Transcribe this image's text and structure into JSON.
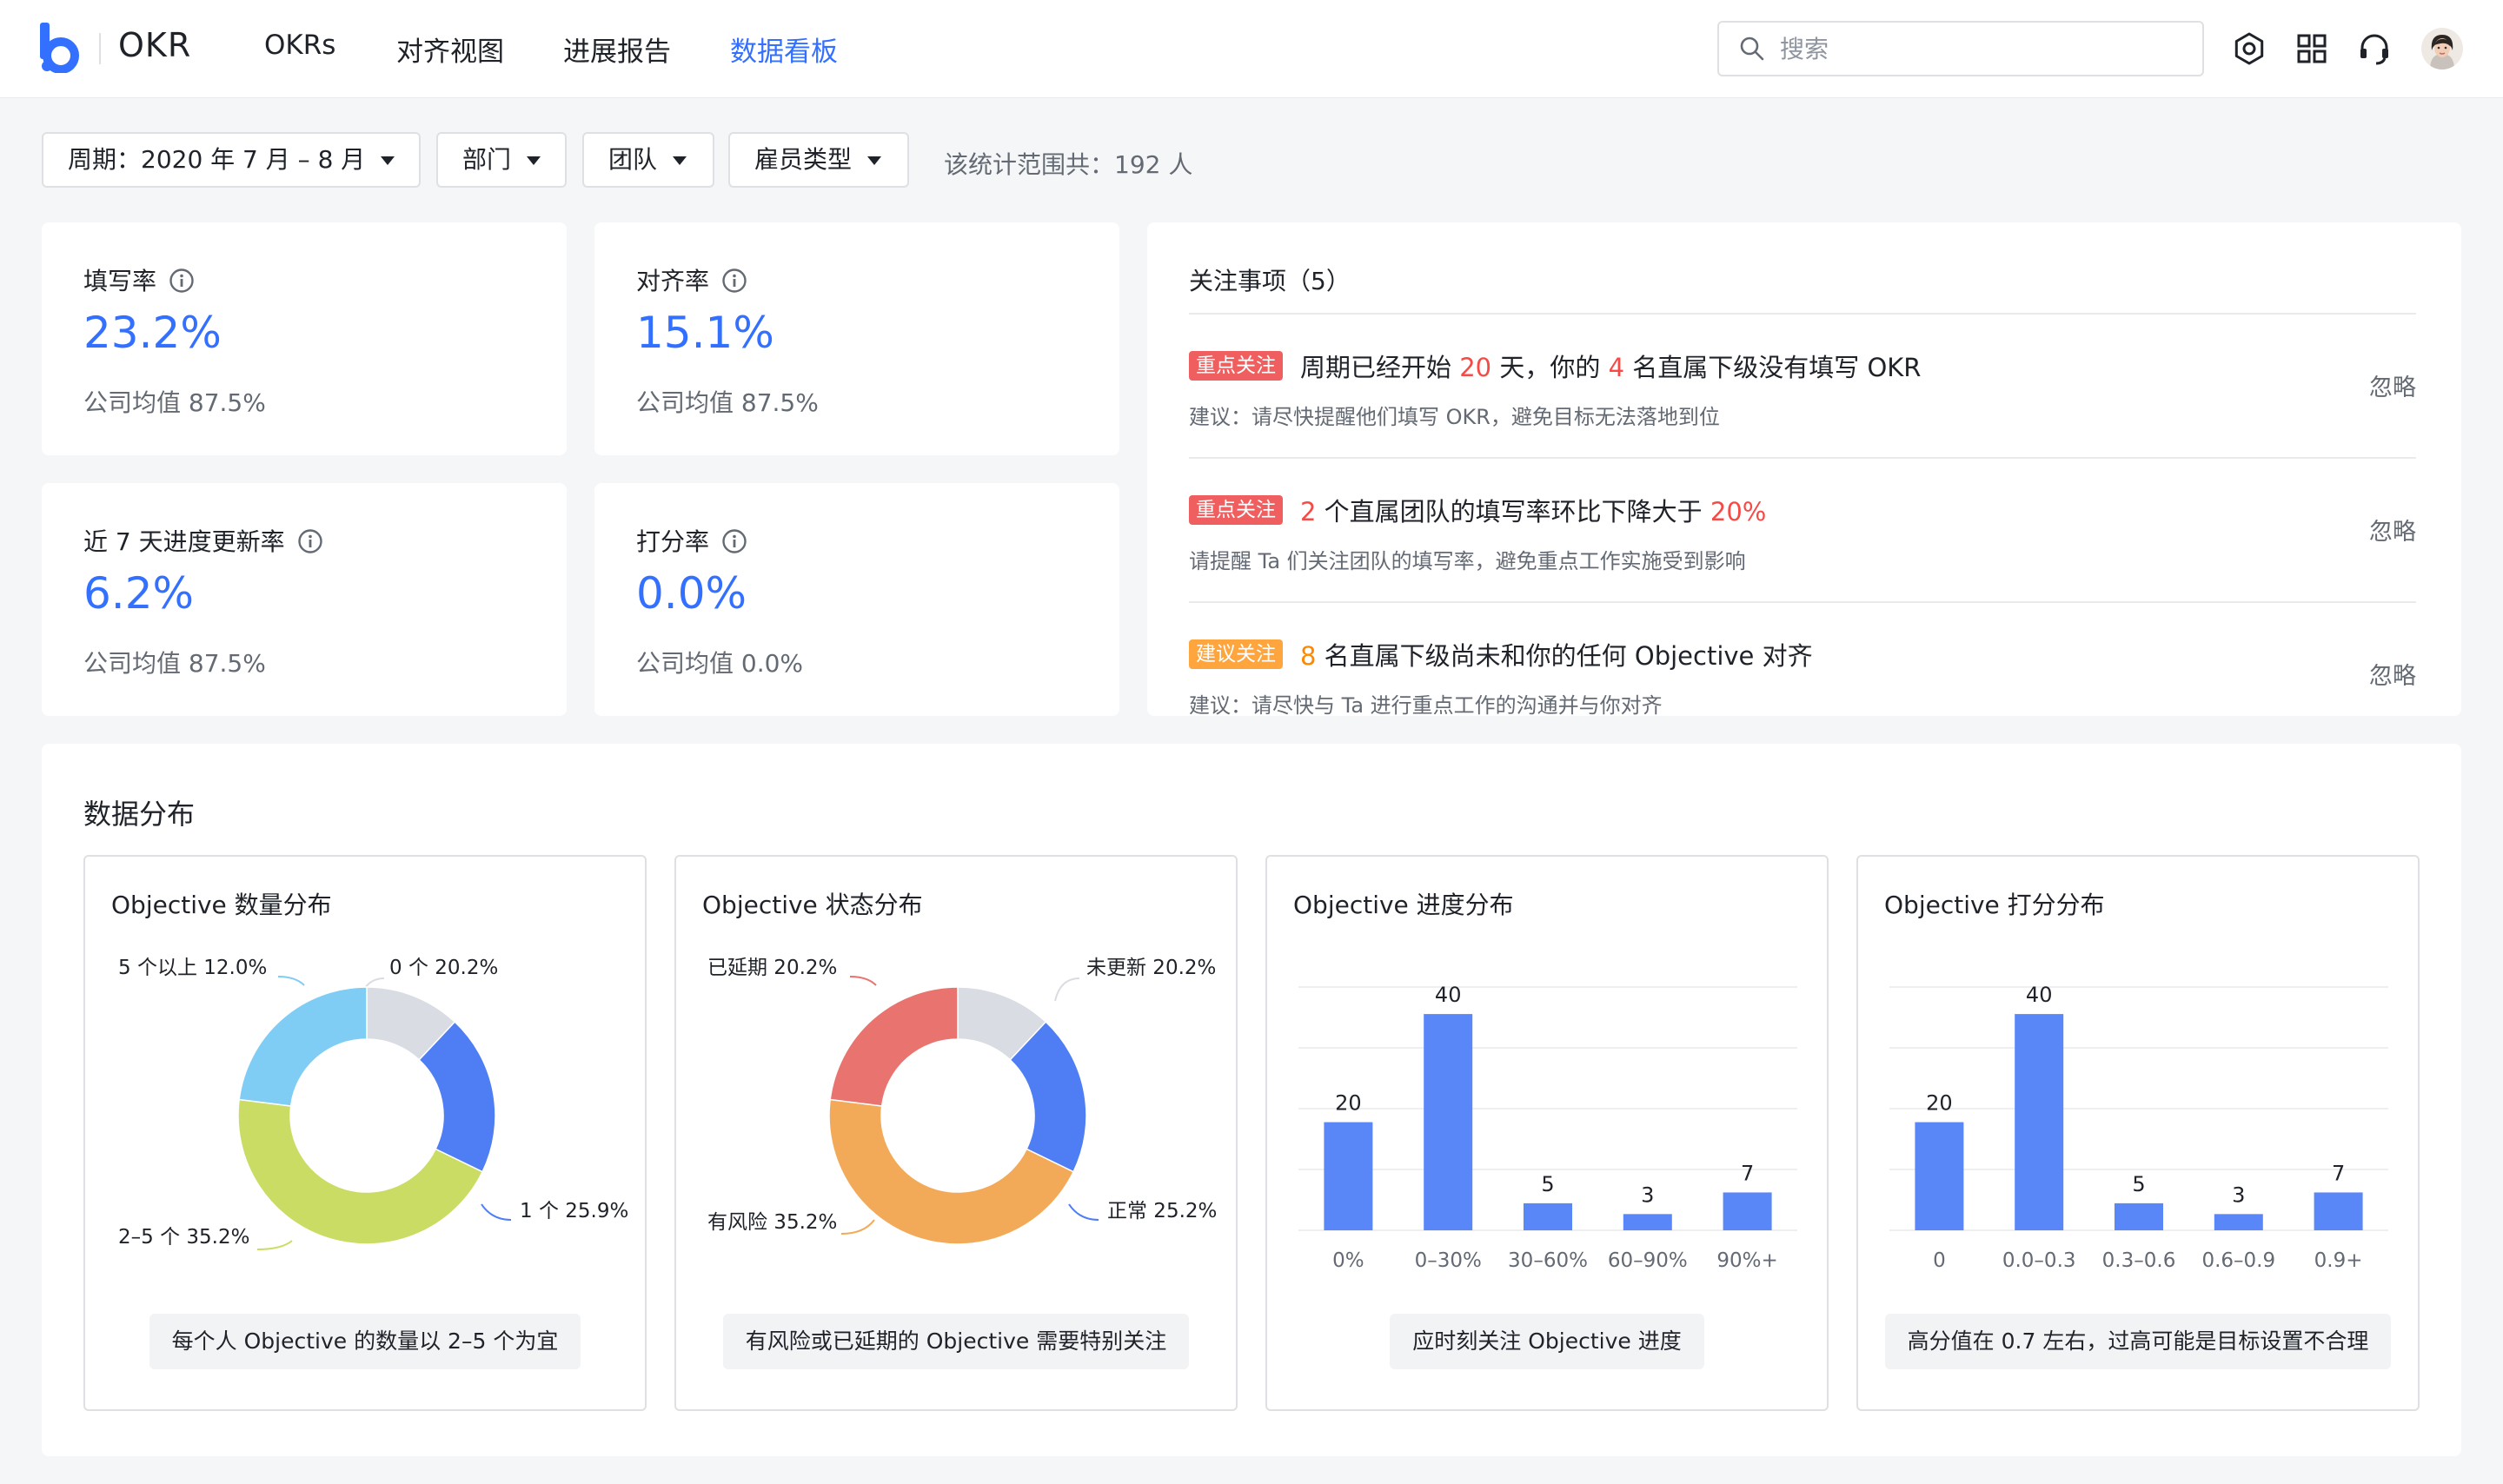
{
  "header": {
    "brand": "OKR",
    "nav": [
      "OKRs",
      "对齐视图",
      "进展报告",
      "数据看板"
    ],
    "active_nav": "数据看板",
    "search_placeholder": "搜索",
    "icons": [
      "settings-icon",
      "apps-grid-icon",
      "headset-icon",
      "avatar"
    ]
  },
  "filters": {
    "period": "周期：2020 年 7 月 – 8 月",
    "department": "部门",
    "team": "团队",
    "employee_type": "雇员类型",
    "scope_note": "该统计范围共：192 人"
  },
  "metrics": [
    {
      "title": "填写率",
      "value": "23.2%",
      "value_fraction": 0.232,
      "sub": "公司均值 87.5%"
    },
    {
      "title": "对齐率",
      "value": "15.1%",
      "value_fraction": 0.151,
      "sub": "公司均值 87.5%"
    },
    {
      "title": "近 7 天进度更新率",
      "value": "6.2%",
      "value_fraction": 0.062,
      "sub": "公司均值 87.5%"
    },
    {
      "title": "打分率",
      "value": "0.0%",
      "value_fraction": 0.0,
      "sub": "公司均值 0.0%"
    }
  ],
  "attention": {
    "title": "关注事项（5）",
    "ignore_label": "忽略",
    "items": [
      {
        "tag": "重点关注",
        "tag_color": "#f05f5f",
        "parts": [
          {
            "t": "周期已经开始 ",
            "c": ""
          },
          {
            "t": "20",
            "c": "red"
          },
          {
            "t": " 天，你的 ",
            "c": ""
          },
          {
            "t": "4",
            "c": "red"
          },
          {
            "t": " 名直属下级没有填写 OKR",
            "c": ""
          }
        ],
        "sub": "建议：请尽快提醒他们填写 OKR，避免目标无法落地到位"
      },
      {
        "tag": "重点关注",
        "tag_color": "#f05f5f",
        "parts": [
          {
            "t": "2",
            "c": "red"
          },
          {
            "t": " 个直属团队的填写率环比下降大于 ",
            "c": ""
          },
          {
            "t": "20%",
            "c": "red"
          }
        ],
        "sub": "请提醒 Ta 们关注团队的填写率，避免重点工作实施受到影响"
      },
      {
        "tag": "建议关注",
        "tag_color": "#ffa53d",
        "parts": [
          {
            "t": "8",
            "c": "orange"
          },
          {
            "t": " 名直属下级尚未和你的任何 Objective 对齐",
            "c": ""
          }
        ],
        "sub": "建议：请尽快与 Ta 进行重点工作的沟通并与你对齐"
      }
    ]
  },
  "distribution": {
    "title": "数据分布"
  },
  "chart_data": [
    {
      "type": "pie",
      "title": "Objective 数量分布",
      "series": [
        {
          "name": "0 个",
          "label": "0 个 20.2%",
          "value": 12.0,
          "color": "#d9dce3"
        },
        {
          "name": "1 个",
          "label": "1 个 25.9%",
          "value": 20.2,
          "color": "#4f7df3"
        },
        {
          "name": "2–5 个",
          "label": "2–5 个 35.2%",
          "value": 44.8,
          "color": "#cbdc65"
        },
        {
          "name": "5 个以上",
          "label": "5 个以上 12.0%",
          "value": 23.0,
          "color": "#7fcdf5"
        }
      ],
      "tip": "每个人 Objective 的数量以 2–5 个为宜"
    },
    {
      "type": "pie",
      "title": "Objective 状态分布",
      "series": [
        {
          "name": "未更新",
          "label": "未更新 20.2%",
          "value": 12.0,
          "color": "#d9dce3"
        },
        {
          "name": "正常",
          "label": "正常 25.2%",
          "value": 20.2,
          "color": "#4f7df3"
        },
        {
          "name": "有风险",
          "label": "有风险 35.2%",
          "value": 44.8,
          "color": "#f3aa58"
        },
        {
          "name": "已延期",
          "label": "已延期 20.2%",
          "value": 23.0,
          "color": "#e9736e"
        }
      ],
      "tip": "有风险或已延期的 Objective 需要特别关注"
    },
    {
      "type": "bar",
      "title": "Objective 进度分布",
      "categories": [
        "0%",
        "0–30%",
        "30–60%",
        "60–90%",
        "90%+"
      ],
      "values": [
        20,
        40,
        5,
        3,
        7
      ],
      "ylim": [
        0,
        45
      ],
      "color": "#5a87f8",
      "tip": "应时刻关注 Objective 进度"
    },
    {
      "type": "bar",
      "title": "Objective 打分分布",
      "categories": [
        "0",
        "0.0–0.3",
        "0.3–0.6",
        "0.6–0.9",
        "0.9+"
      ],
      "values": [
        20,
        40,
        5,
        3,
        7
      ],
      "ylim": [
        0,
        45
      ],
      "color": "#5a87f8",
      "tip": "高分值在 0.7 左右，过高可能是目标设置不合理"
    }
  ]
}
